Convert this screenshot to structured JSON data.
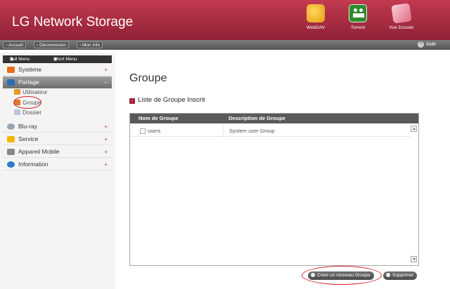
{
  "header": {
    "title": "LG Network Storage",
    "shortcuts": [
      {
        "label": "WebDAV",
        "icon": "webdav-icon"
      },
      {
        "label": "Torrent",
        "icon": "torrent-icon"
      },
      {
        "label": "Vue Dossier",
        "icon": "folder-view-icon"
      }
    ]
  },
  "toolbar": {
    "buttons": [
      "Accueil",
      "Déconnexion",
      "Mon Info"
    ],
    "help": "Aide"
  },
  "sidebar": {
    "tabs": [
      "Full Menu",
      "Short Menu"
    ],
    "items": [
      {
        "label": "Système",
        "icon": "system-icon",
        "color": "#e8701a"
      },
      {
        "label": "Partage",
        "icon": "share-icon",
        "color": "#2f6db5",
        "active": true,
        "children": [
          {
            "label": "Utilisateur",
            "icon": "user-icon"
          },
          {
            "label": "Groupe",
            "icon": "group-icon",
            "selected": true
          },
          {
            "label": "Dossier",
            "icon": "folder-icon"
          }
        ]
      },
      {
        "label": "Blu-ray",
        "icon": "bluray-icon",
        "color": "#9aa6b2"
      },
      {
        "label": "Service",
        "icon": "star-icon",
        "color": "#f2b705"
      },
      {
        "label": "Appareil Mobile",
        "icon": "mobile-icon",
        "color": "#888888"
      },
      {
        "label": "Information",
        "icon": "info-icon",
        "color": "#2a7ac8"
      }
    ]
  },
  "main": {
    "title": "Groupe",
    "section": "Liste de Groupe Inscrit",
    "table": {
      "columns": [
        "Nom de Groupe",
        "Description de Groupe"
      ],
      "rows": [
        [
          "users",
          "System user Group"
        ]
      ]
    },
    "buttons": {
      "create": "Créer un nouveau Groupe",
      "delete": "Supprimer"
    }
  },
  "colors": {
    "header": "#a62a40",
    "highlight": "#d0222a"
  }
}
